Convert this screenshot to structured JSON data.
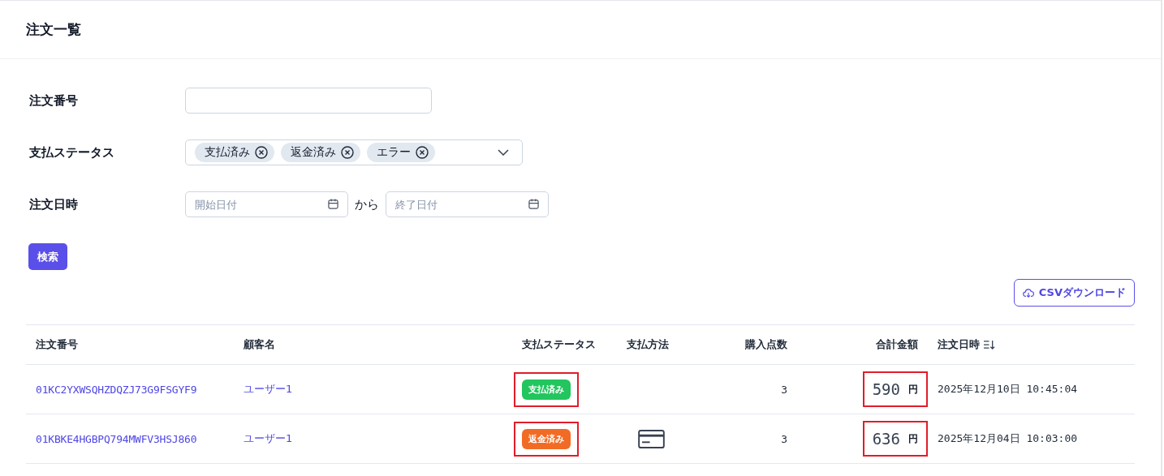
{
  "header": {
    "title": "注文一覧"
  },
  "filters": {
    "order_number": {
      "label": "注文番号"
    },
    "payment_status": {
      "label": "支払ステータス",
      "chips": [
        "支払済み",
        "返金済み",
        "エラー"
      ]
    },
    "order_date": {
      "label": "注文日時",
      "start_placeholder": "開始日付",
      "separator": "から",
      "end_placeholder": "終了日付"
    },
    "search_button": "検索"
  },
  "csv_button": "CSVダウンロード",
  "table": {
    "columns": [
      "注文番号",
      "顧客名",
      "支払ステータス",
      "支払方法",
      "購入点数",
      "合計金額",
      "注文日時"
    ],
    "rows": [
      {
        "order_number": "01KC2YXWSQHZDQZJ73G9FSGYF9",
        "customer": "ユーザー1",
        "status": {
          "label": "支払済み",
          "kind": "paid",
          "highlighted": true
        },
        "quantity": "3",
        "amount": {
          "value": "590",
          "unit": "円",
          "highlighted": true
        },
        "date": "2025年12月10日 10:45:04"
      },
      {
        "order_number": "01KBKE4HGBPQ794MWFV3HSJ860",
        "customer": "ユーザー1",
        "status": {
          "label": "返金済み",
          "kind": "refunded",
          "highlighted": true
        },
        "payment_method": {
          "kind": "card"
        },
        "quantity": "3",
        "amount": {
          "value": "636",
          "unit": "円",
          "highlighted": true
        },
        "date": "2025年12月04日 10:03:00"
      }
    ]
  }
}
